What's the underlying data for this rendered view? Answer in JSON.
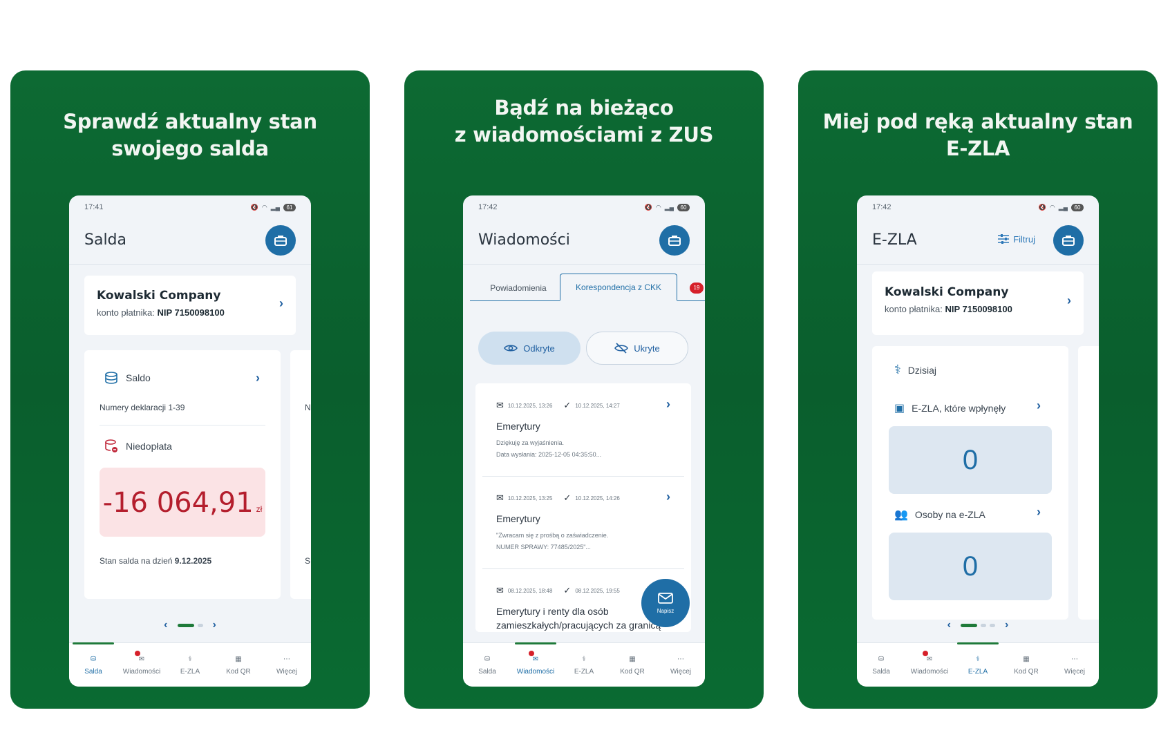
{
  "cards": [
    {
      "headline": [
        "Sprawdź aktualny stan",
        "swojego salda"
      ],
      "phone": {
        "time": "17:41",
        "battery": "61",
        "title": "Salda",
        "company": {
          "name": "Kowalski Company",
          "sub_label": "konto płatnika:",
          "nip": "NIP 7150098100"
        },
        "saldo_label": "Saldo",
        "declarations": "Numery deklaracji 1-39",
        "niedoplata_label": "Niedopłata",
        "amount": "-16 064,91",
        "currency": "zł",
        "balance_date_label": "Stan salda na dzień",
        "balance_date": "9.12.2025",
        "peek_letters": [
          "N",
          "S"
        ]
      }
    },
    {
      "headline": [
        "Bądź na bieżąco",
        "z wiadomościami z ZUS"
      ],
      "phone": {
        "time": "17:42",
        "battery": "60",
        "title": "Wiadomości",
        "tabs": [
          "Powiadomienia",
          "Korespondencja z CKK"
        ],
        "tab_badge": "19",
        "segments": [
          "Odkryte",
          "Ukryte"
        ],
        "messages": [
          {
            "sent": "10.12.2025, 13:26",
            "read": "10.12.2025, 14:27",
            "title": "Emerytury",
            "body": [
              "Dziękuję za wyjaśnienia.",
              "Data wysłania: 2025-12-05 04:35:50..."
            ]
          },
          {
            "sent": "10.12.2025, 13:25",
            "read": "10.12.2025, 14:26",
            "title": "Emerytury",
            "body": [
              "\"Zwracam się z prośbą o zaświadczenie.",
              "NUMER SPRAWY: 77485/2025\"..."
            ]
          },
          {
            "sent": "08.12.2025, 18:48",
            "read": "08.12.2025, 19:55",
            "title": "Emerytury i renty dla osób",
            "body_large": "zamieszkałych/pracujących za granicą"
          }
        ],
        "fab_label": "Napisz"
      }
    },
    {
      "headline": [
        "Miej pod ręką aktualny stan",
        "E-ZLA"
      ],
      "phone": {
        "time": "17:42",
        "battery": "60",
        "title": "E-ZLA",
        "filter_label": "Filtruj",
        "company": {
          "name": "Kowalski Company",
          "sub_label": "konto płatnika:",
          "nip": "NIP 7150098100"
        },
        "today_label": "Dzisiaj",
        "received_label": "E-ZLA, które wpłynęły",
        "received_count": "0",
        "persons_label": "Osoby na e-ZLA",
        "persons_count": "0"
      }
    }
  ],
  "nav": [
    "Salda",
    "Wiadomości",
    "E-ZLA",
    "Kod QR",
    "Więcej"
  ],
  "colors": {
    "brand_green": "#0a5e2d",
    "accent_blue": "#1f6ea6",
    "debt_bg": "#fbe3e5",
    "debt_text": "#b41e2d"
  }
}
